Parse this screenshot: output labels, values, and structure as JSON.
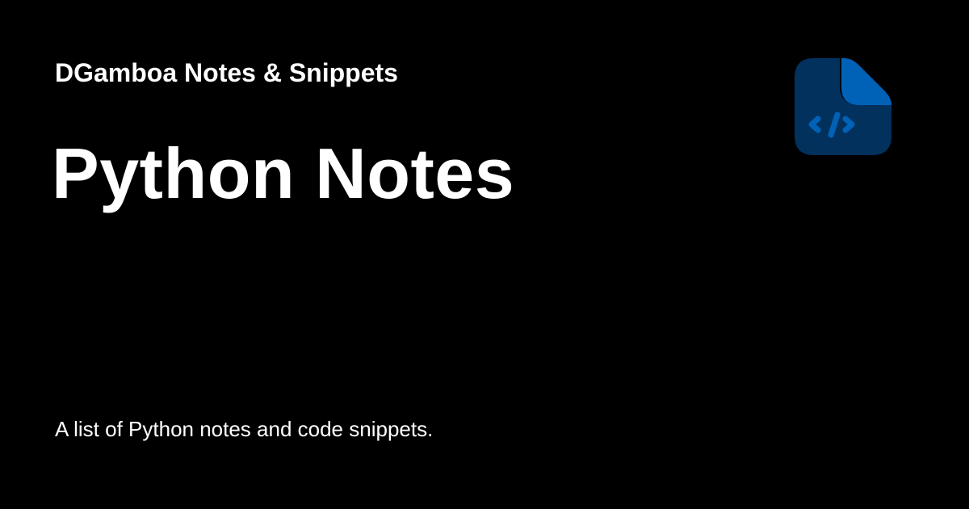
{
  "site": {
    "title": "DGamboa Notes & Snippets"
  },
  "page": {
    "title": "Python Notes",
    "description": "A list of Python notes and code snippets."
  },
  "logo": {
    "icon": "code-file-icon",
    "colors": {
      "body": "#02315e",
      "fold": "#0062b7",
      "glyph": "#0062b7"
    }
  },
  "colors": {
    "background": "#000000",
    "text": "#ffffff"
  }
}
